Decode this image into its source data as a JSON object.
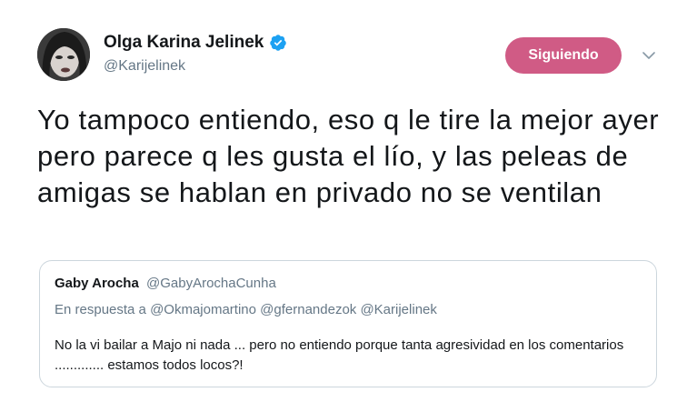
{
  "author": {
    "display_name": "Olga Karina Jelinek",
    "handle": "@Karijelinek",
    "verified": true
  },
  "follow_button": {
    "label": "Siguiendo",
    "color": "#d05b85"
  },
  "menu": {
    "icon": "chevron-down-icon"
  },
  "tweet": {
    "text": "Yo tampoco entiendo, eso q le tire la mejor ayer pero parece q les gusta el lío, y las peleas de amigas se hablan en privado no se ventilan"
  },
  "quoted_tweet": {
    "author_name": "Gaby Arocha",
    "author_handle": "@GabyArochaCunha",
    "reply_to": "En respuesta a @Okmajomartino @gfernandezok @Karijelinek",
    "text": "No la vi bailar a Majo ni nada ... pero no entiendo porque tanta agresividad en los comentarios ............. estamos todos locos?!"
  },
  "colors": {
    "verified_badge": "#1da1f2",
    "secondary_text": "#657786",
    "border": "#ccd6dd"
  }
}
